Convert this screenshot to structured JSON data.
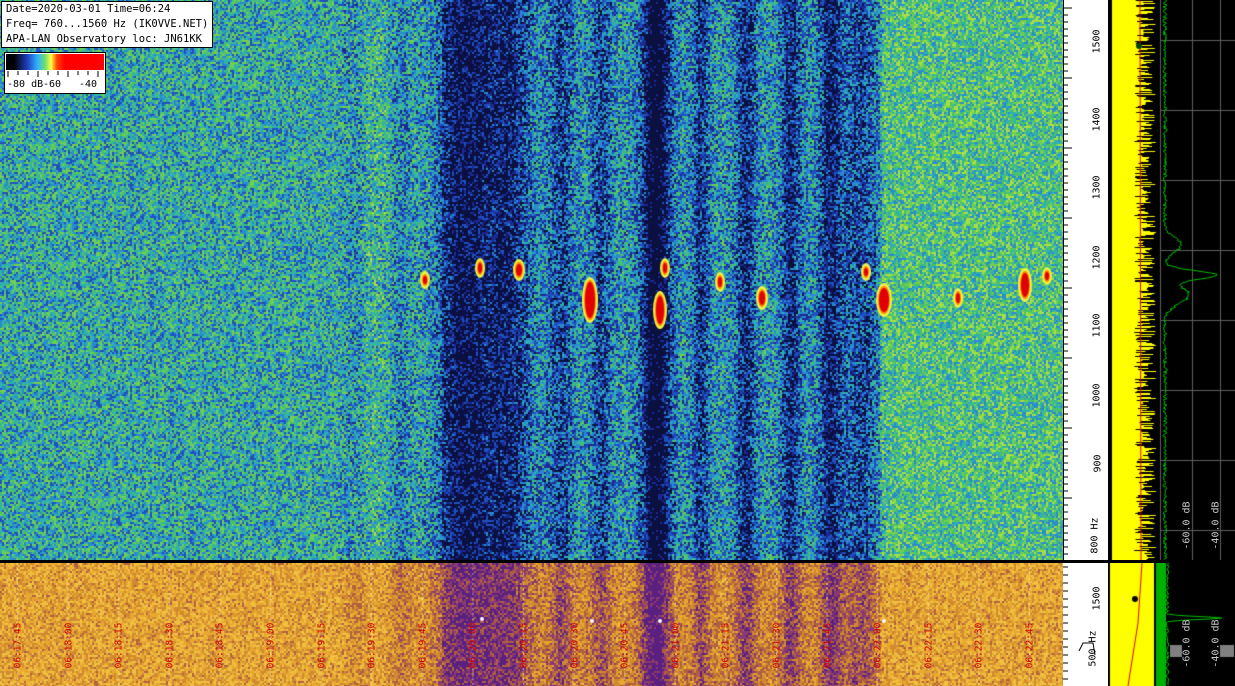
{
  "header": {
    "line1": "Date=2020-03-01 Time=06:24",
    "line2": "Freq= 760...1560 Hz (IK0VVE.NET)",
    "line3": "APA-LAN Observatory loc: JN61KK"
  },
  "legend": {
    "label_left": "-80 dB",
    "label_mid": "-60",
    "label_right": "-40"
  },
  "freq_axis_top": {
    "labels": [
      "1500",
      "1400",
      "1300",
      "1200",
      "1100",
      "1000",
      "900",
      "800 Hz"
    ]
  },
  "freq_axis_bottom": {
    "labels": [
      "1500",
      "500 Hz"
    ]
  },
  "spectrum_top": {
    "db_labels": [
      "-60.0 dB",
      "-40.0 dB"
    ]
  },
  "spectrum_bottom": {
    "db_labels": [
      "-60.0 dB",
      "-40.0 dB"
    ]
  },
  "time_axis": {
    "labels": [
      "06:17:45",
      "06:18:00",
      "06:18:15",
      "06:18:30",
      "06:18:45",
      "06:19:00",
      "06:19:15",
      "06:19:30",
      "06:19:45",
      "06:20:00",
      "06:20:15",
      "06:20:30",
      "06:20:45",
      "06:21:00",
      "06:21:15",
      "06:21:30",
      "06:21:45",
      "06:22:00",
      "06:22:15",
      "06:22:30",
      "06:22:45"
    ]
  },
  "colors": {
    "waterfall_green": "#40b060",
    "waterfall_blue": "#1a3aa0",
    "trace_yellow": "#ffff00",
    "trace_green": "#00c000",
    "time_red": "#d00000"
  }
}
